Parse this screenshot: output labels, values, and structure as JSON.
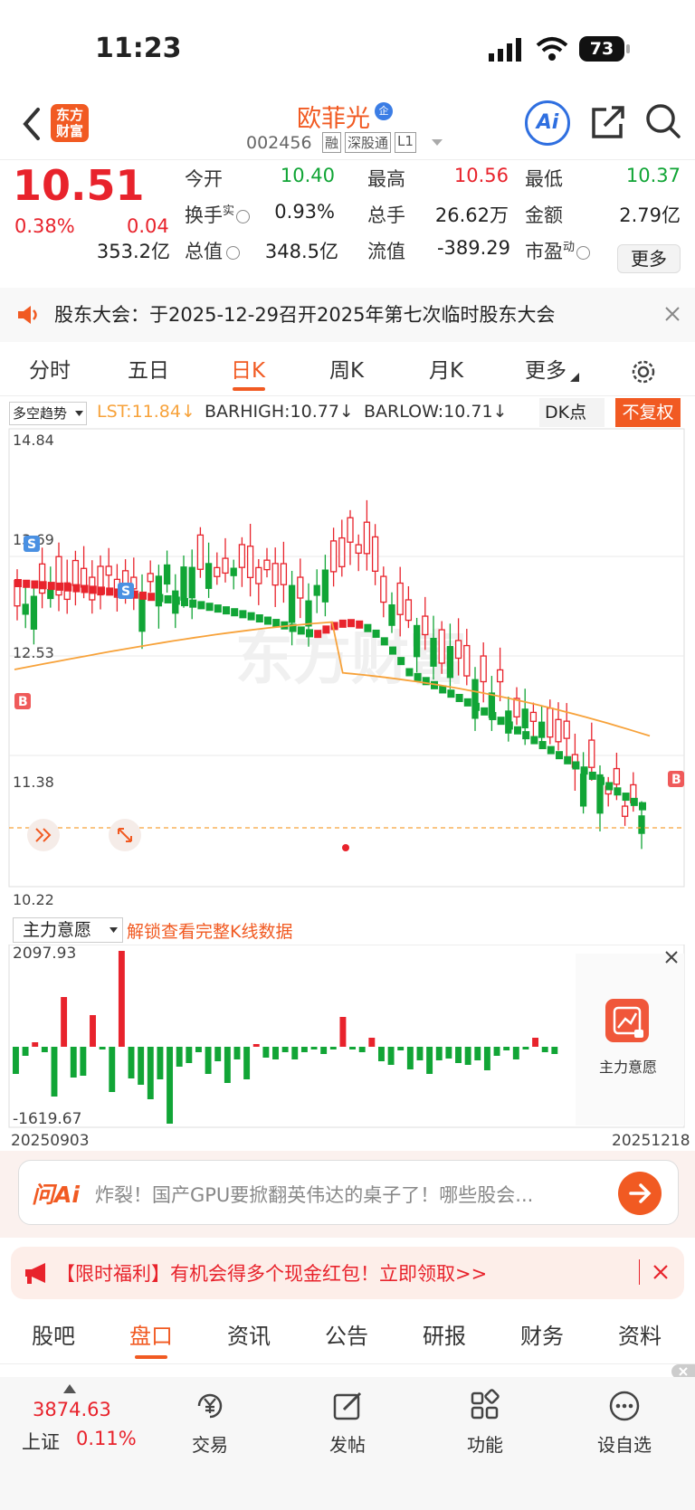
{
  "status": {
    "time": "11:23",
    "battery": "73"
  },
  "header": {
    "logo_line1": "东方",
    "logo_line2": "财富",
    "name": "欧菲光",
    "badge": "企",
    "code": "002456",
    "tags": [
      "融",
      "深股通",
      "L1"
    ],
    "ai_label": "Ai",
    "icons": [
      "back-icon",
      "share-icon",
      "search-icon"
    ]
  },
  "quote": {
    "price": "10.51",
    "change_pct": "0.38%",
    "change": "0.04",
    "rows": [
      [
        {
          "l": "今开",
          "v": "10.40",
          "c": "green"
        },
        {
          "l": "最高",
          "v": "10.56",
          "c": "red"
        },
        {
          "l": "最低",
          "v": "10.37",
          "c": "green"
        }
      ],
      [
        {
          "l": "换手",
          "sup": "实",
          "v": "0.93%",
          "c": "dark"
        },
        {
          "l": "总手",
          "v": "26.62万",
          "c": "dark"
        },
        {
          "l": "金额",
          "v": "2.79亿",
          "c": "dark"
        }
      ],
      [
        {
          "l": "总值",
          "v": "353.2亿",
          "c": "dark"
        },
        {
          "l": "流值",
          "v": "348.5亿",
          "c": "dark"
        },
        {
          "l": "市盈",
          "sup": "动",
          "v": "-389.29",
          "c": "dark"
        }
      ]
    ],
    "more_button": "更多"
  },
  "notice": {
    "text": "股东大会：于2025-12-29召开2025年第七次临时股东大会"
  },
  "tabs": {
    "items": [
      "分时",
      "五日",
      "日K",
      "周K",
      "月K",
      "更多"
    ],
    "active": 2
  },
  "kchart": {
    "indicator_select": "多空趋势",
    "lst": "LST:11.84↓",
    "barhigh": "BARHIGH:10.77↓",
    "barlow": "BARLOW:10.71↓",
    "dk_button": "DK点",
    "fq_button": "不复权",
    "watermark": "东方财富",
    "yaxis": [
      "14.84",
      "13.69",
      "12.53",
      "11.38",
      "10.22"
    ],
    "signals": [
      "S",
      "S",
      "B",
      "B"
    ]
  },
  "subchart": {
    "select": "主力意愿",
    "unlock_text": "解锁查看完整K线数据",
    "ymax": "2097.93",
    "ymin": "-1619.67",
    "date_start": "20250903",
    "date_end": "20251218",
    "side_label": "主力意愿"
  },
  "ask": {
    "logo": "问Ai",
    "placeholder": "炸裂！国产GPU要掀翻英伟达的桌子了！哪些股会..."
  },
  "promo": {
    "text": "【限时福利】有机会得多个现金红包！立即领取>>"
  },
  "subtabs": {
    "items": [
      "股吧",
      "盘口",
      "资讯",
      "公告",
      "研报",
      "财务",
      "资料"
    ],
    "active": 1
  },
  "bottom": {
    "index_value": "3874.63",
    "index_name": "上证",
    "index_pct": "0.11%",
    "items": [
      "交易",
      "发帖",
      "功能",
      "设自选"
    ]
  },
  "colors": {
    "up": "#e8232c",
    "down": "#11a536",
    "accent": "#ff5a1f",
    "ma": "#f7a23a"
  }
}
